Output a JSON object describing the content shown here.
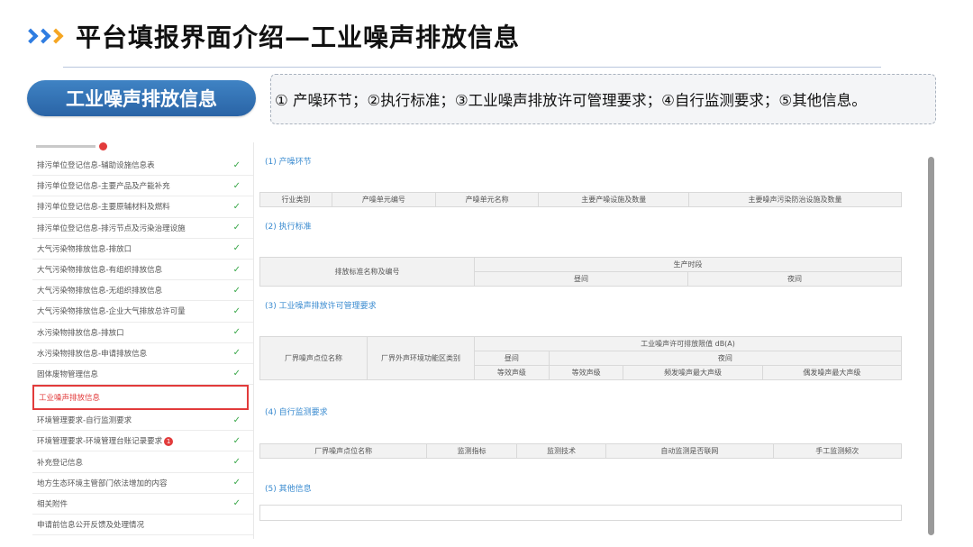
{
  "header": {
    "title": "平台填报界面介绍—工业噪声排放信息",
    "pill_label": "工业噪声排放信息",
    "description": "①  产噪环节；②执行标准；③工业噪声排放许可管理要求；④自行监测要求；⑤其他信息。"
  },
  "colors": {
    "accent_blue": "#2f7de1",
    "accent_orange": "#f5a623",
    "pill": "#2f6fb3",
    "highlight": "#e23b3b",
    "section_title": "#3a8bd0",
    "check": "#3aa84a"
  },
  "sidebar": {
    "items": [
      {
        "label": "排污单位登记信息-辅助设施信息表",
        "check": "✓",
        "active": false
      },
      {
        "label": "排污单位登记信息-主要产品及产能补充",
        "check": "✓",
        "active": false
      },
      {
        "label": "排污单位登记信息-主要原辅材料及燃料",
        "check": "✓",
        "active": false
      },
      {
        "label": "排污单位登记信息-排污节点及污染治理设施",
        "check": "✓",
        "active": false
      },
      {
        "label": "大气污染物排放信息-排放口",
        "check": "✓",
        "active": false
      },
      {
        "label": "大气污染物排放信息-有组织排放信息",
        "check": "✓",
        "active": false
      },
      {
        "label": "大气污染物排放信息-无组织排放信息",
        "check": "✓",
        "active": false
      },
      {
        "label": "大气污染物排放信息-企业大气排放总许可量",
        "check": "✓",
        "active": false
      },
      {
        "label": "水污染物排放信息-排放口",
        "check": "✓",
        "active": false
      },
      {
        "label": "水污染物排放信息-申请排放信息",
        "check": "✓",
        "active": false
      },
      {
        "label": "固体废物管理信息",
        "check": "✓",
        "active": false
      },
      {
        "label": "工业噪声排放信息",
        "check": "",
        "active": true
      },
      {
        "label": "环境管理要求-自行监测要求",
        "check": "✓",
        "active": false
      },
      {
        "label": "环境管理要求-环境管理台账记录要求",
        "check": "✓",
        "active": false,
        "badge": "1"
      },
      {
        "label": "补充登记信息",
        "check": "✓",
        "active": false
      },
      {
        "label": "地方生态环境主管部门依法增加的内容",
        "check": "✓",
        "active": false
      },
      {
        "label": "相关附件",
        "check": "✓",
        "active": false
      },
      {
        "label": "申请前信息公开反馈及处理情况",
        "check": "",
        "active": false
      }
    ]
  },
  "sections": {
    "s1": {
      "title": "(1) 产噪环节",
      "headers": [
        "行业类别",
        "产噪单元编号",
        "产噪单元名称",
        "主要产噪设施及数量",
        "主要噪声污染防治设施及数量"
      ]
    },
    "s2": {
      "title": "(2) 执行标准",
      "col1": "排放标准名称及编号",
      "group": "生产时段",
      "day": "昼间",
      "night": "夜间"
    },
    "s3": {
      "title": "(3) 工业噪声排放许可管理要求",
      "col1": "厂界噪声点位名称",
      "col2": "厂界外声环境功能区类别",
      "group": "工业噪声许可排放限值 dB(A)",
      "day": "昼间",
      "night": "夜间",
      "sub": [
        "等效声级",
        "等效声级",
        "频发噪声最大声级",
        "偶发噪声最大声级"
      ]
    },
    "s4": {
      "title": "(4) 自行监测要求",
      "headers": [
        "厂界噪声点位名称",
        "监测指标",
        "监测技术",
        "自动监测是否联网",
        "手工监测频次"
      ]
    },
    "s5": {
      "title": "(5) 其他信息"
    }
  }
}
